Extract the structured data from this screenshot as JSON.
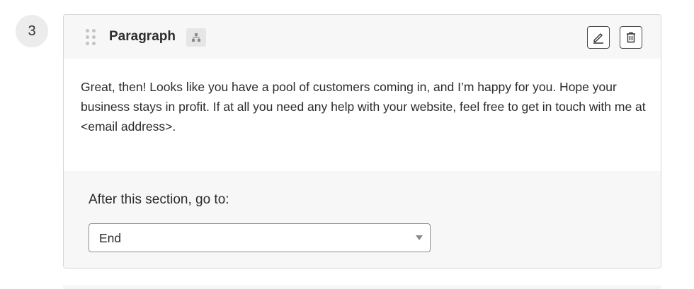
{
  "section": {
    "number": "3",
    "block_type": "Paragraph",
    "icons": {
      "drag": "drag-handle-icon",
      "logic": "branch-logic-icon",
      "edit": "pencil-icon",
      "delete": "trash-icon"
    },
    "body_text": "Great, then! Looks like you have a pool of customers coming in, and I’m happy for you. Hope your business stays in profit. If at all you need any help with your website, feel free to get in touch with me at <email address>.",
    "after_section": {
      "label": "After this section, go to:",
      "selected": "End"
    }
  }
}
